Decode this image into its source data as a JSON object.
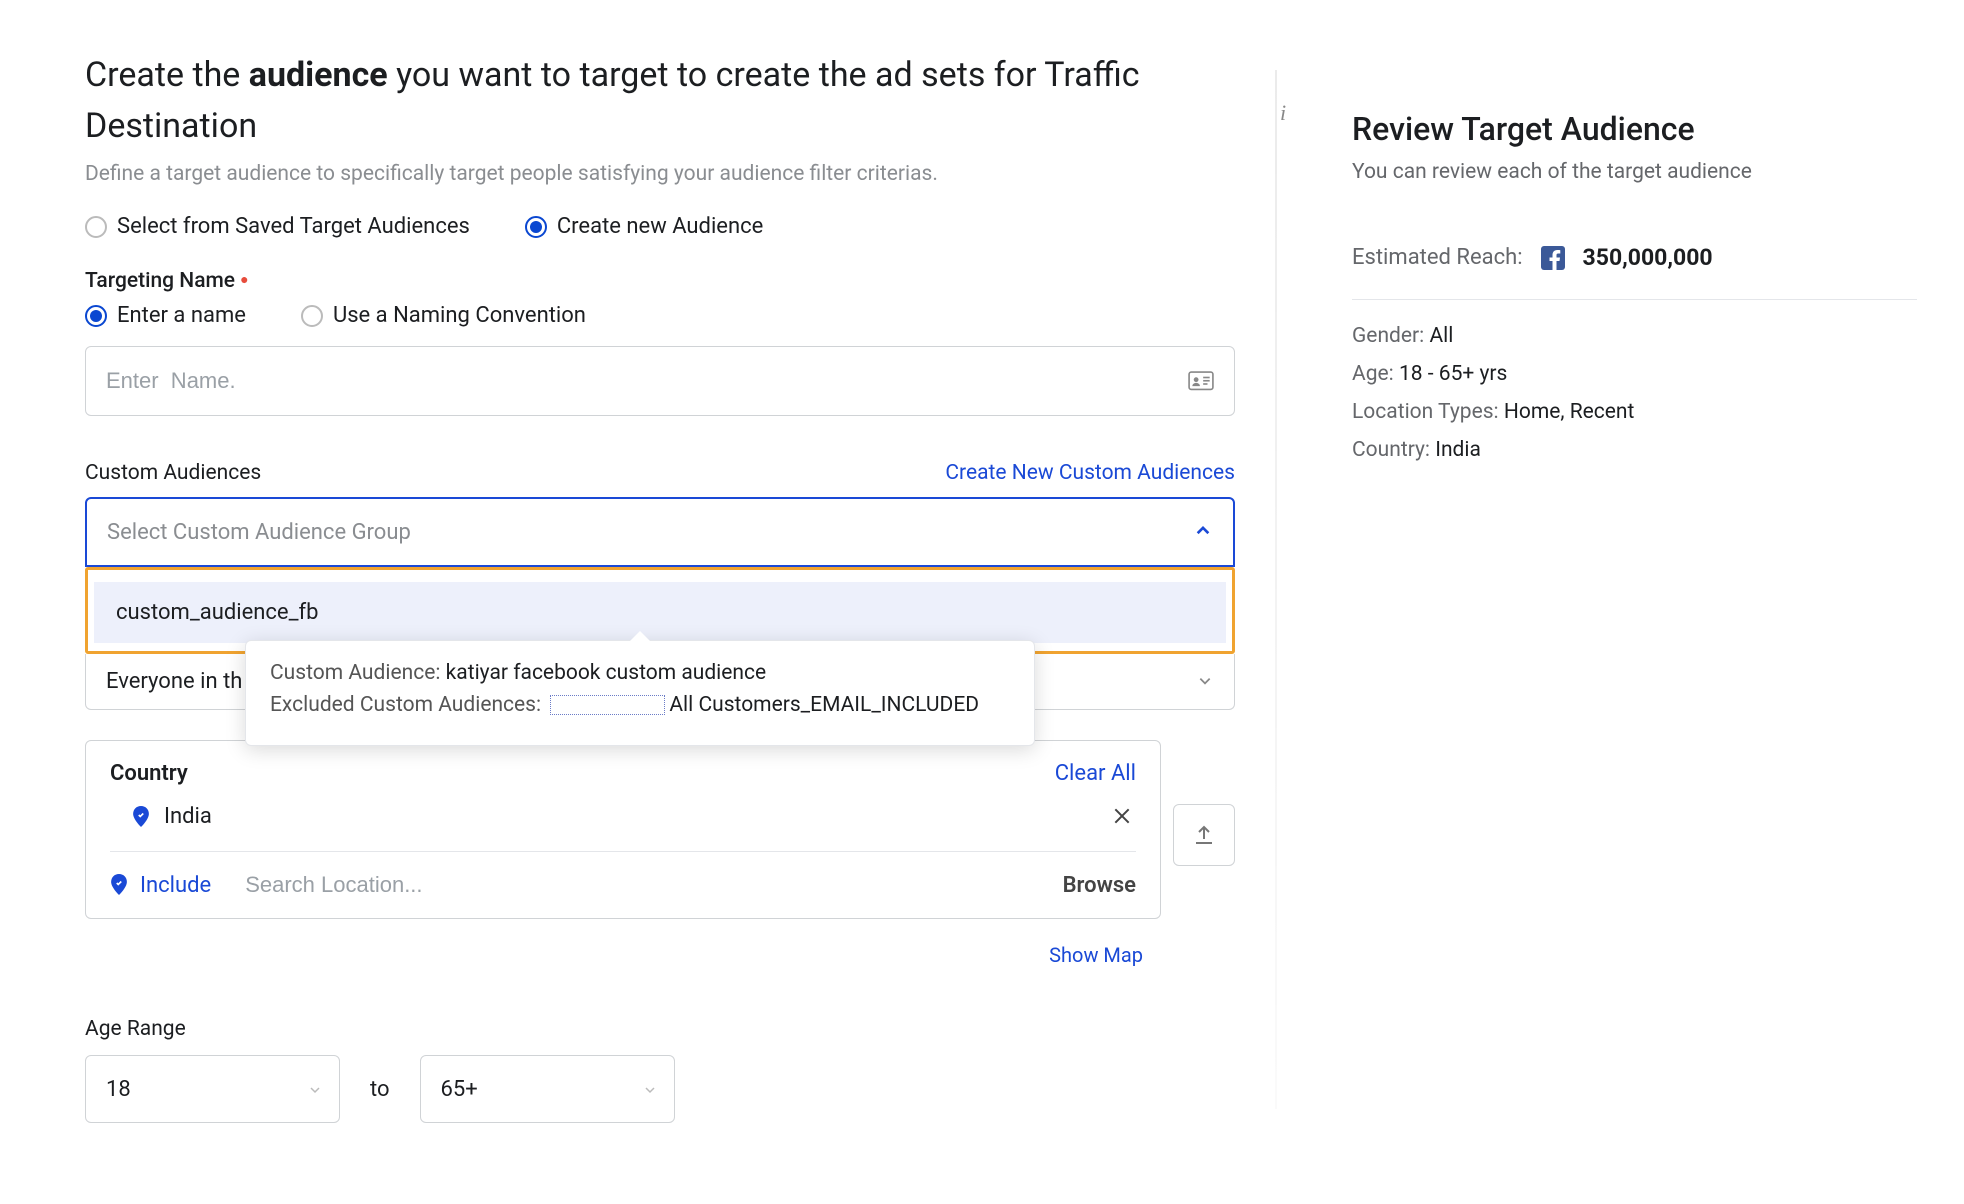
{
  "header": {
    "title_prefix": "Create the ",
    "title_bold": "audience",
    "title_suffix": " you want to target to create the ad sets for Traffic Destination",
    "subtitle": "Define a target audience to specifically target people satisfying your audience filter criterias."
  },
  "audience_source": {
    "saved_label": "Select from Saved Target Audiences",
    "new_label": "Create new Audience"
  },
  "targeting_name": {
    "label": "Targeting Name",
    "enter_label": "Enter a name",
    "convention_label": "Use a Naming Convention",
    "placeholder": "Enter  Name."
  },
  "custom_audiences": {
    "label": "Custom Audiences",
    "create_link": "Create New Custom Audiences",
    "placeholder": "Select Custom Audience Group",
    "option": "custom_audience_fb",
    "tooltip": {
      "ca_label": "Custom Audience:",
      "ca_value": "katiyar facebook custom audience",
      "ex_label": "Excluded Custom Audiences:",
      "ex_value": "All Customers_EMAIL_INCLUDED"
    },
    "everyone_text": "Everyone in th"
  },
  "country": {
    "title": "Country",
    "clear_all": "Clear All",
    "item": "India",
    "include_label": "Include",
    "search_placeholder": "Search Location...",
    "browse": "Browse",
    "show_map": "Show Map"
  },
  "age": {
    "label": "Age Range",
    "from": "18",
    "to_label": "to",
    "to": "65+"
  },
  "side": {
    "title": "Review Target Audience",
    "desc": "You can review each of the target audience",
    "reach_label": "Estimated Reach:",
    "reach_value": "350,000,000",
    "gender_k": "Gender:",
    "gender_v": "All",
    "age_k": "Age:",
    "age_v": "18 - 65+ yrs",
    "loc_k": "Location Types:",
    "loc_v": "Home, Recent",
    "country_k": "Country:",
    "country_v": "India"
  }
}
